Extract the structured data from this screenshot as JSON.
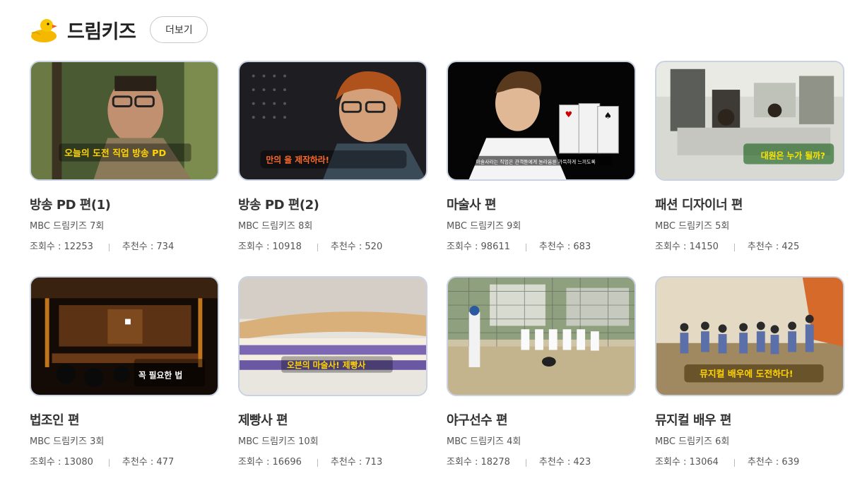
{
  "header": {
    "title": "드림키즈",
    "more_label": "더보기",
    "logo_icon": "rubber-duck-icon"
  },
  "items": [
    {
      "title": "방송 PD 편(1)",
      "sub": "MBC 드림키즈 7회",
      "views_label": "조회수 : 12253",
      "likes_label": "추천수 : 734",
      "caption": "오늘의 도전 직업 방송 PD"
    },
    {
      "title": "방송 PD 편(2)",
      "sub": "MBC 드림키즈 8회",
      "views_label": "조회수 : 10918",
      "likes_label": "추천수 : 520",
      "caption": "만의 을 제작하라!"
    },
    {
      "title": "마술사 편",
      "sub": "MBC 드림키즈 9회",
      "views_label": "조회수 : 98611",
      "likes_label": "추천수 : 683",
      "caption": "마술사라는 직업은 관객들에게 놀라움을 가득하게 느끼도록"
    },
    {
      "title": "패션 디자이너 편",
      "sub": "MBC 드림키즈 5회",
      "views_label": "조회수 : 14150",
      "likes_label": "추천수 : 425",
      "caption": "대원은 누가 될까?"
    },
    {
      "title": "법조인 편",
      "sub": "MBC 드림키즈 3회",
      "views_label": "조회수 : 13080",
      "likes_label": "추천수 : 477",
      "caption": "꼭 필요한 법"
    },
    {
      "title": "제빵사 편",
      "sub": "MBC 드림키즈 10회",
      "views_label": "조회수 : 16696",
      "likes_label": "추천수 : 713",
      "caption": "오븐의 마술사! 제빵사"
    },
    {
      "title": "야구선수 편",
      "sub": "MBC 드림키즈 4회",
      "views_label": "조회수 : 18278",
      "likes_label": "추천수 : 423",
      "caption": ""
    },
    {
      "title": "뮤지컬 배우 편",
      "sub": "MBC 드림키즈 6회",
      "views_label": "조회수 : 13064",
      "likes_label": "추천수 : 639",
      "caption": "뮤지컬 배우에 도전하다!"
    }
  ]
}
